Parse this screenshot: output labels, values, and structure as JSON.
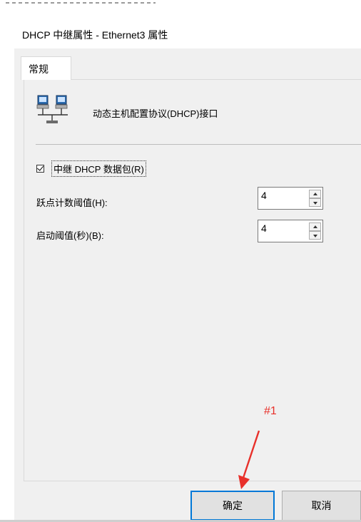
{
  "title_bar": {
    "title": "DHCP 中继属性 - Ethernet3 属性"
  },
  "tabs": [
    {
      "label": "常规"
    }
  ],
  "header": {
    "icon": "network-computers-icon",
    "title": "动态主机配置协议(DHCP)接口"
  },
  "relay_checkbox": {
    "label": "中继 DHCP 数据包(R)",
    "checked": true
  },
  "hop_count": {
    "label": "跃点计数阈值(H):",
    "value": "4"
  },
  "boot_threshold": {
    "label": "启动阈值(秒)(B):",
    "value": "4"
  },
  "annotation": {
    "text": "#1",
    "color": "#e8302a"
  },
  "buttons": {
    "ok": "确定",
    "cancel": "取消"
  }
}
